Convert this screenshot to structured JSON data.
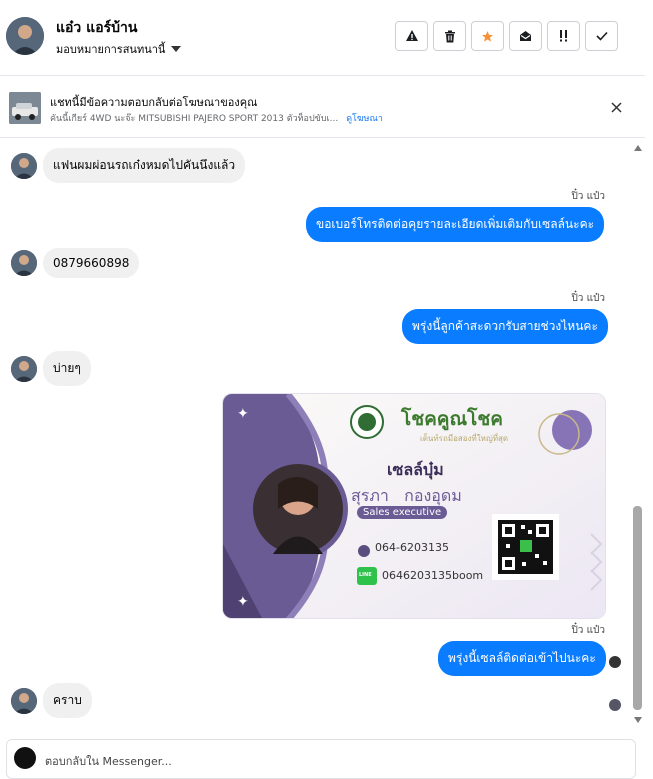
{
  "header": {
    "name": "แอ๋ว แอร์บ้าน",
    "assign_label": "มอบหมายการสนทนานี้",
    "tools": [
      {
        "icon": "warning-icon",
        "glyph": "⚠"
      },
      {
        "icon": "trash-icon",
        "glyph": "🗑"
      },
      {
        "icon": "star-icon",
        "glyph": "★"
      },
      {
        "icon": "mark-unread-icon",
        "glyph": "✉"
      },
      {
        "icon": "follow-up-icon",
        "glyph": "!"
      },
      {
        "icon": "done-icon",
        "glyph": "✓"
      }
    ],
    "star_color": "#f7923a"
  },
  "ad": {
    "title": "แชทนี้มีข้อความตอบกลับต่อโฆษณาของคุณ",
    "subtitle": "คันนี้เกียร์ 4WD นะจ๊ะ MITSUBISHI PAJERO SPORT 2013 ตัวท็อปขับเ...",
    "link": "ดูโฆษณา"
  },
  "messages": {
    "m1": "แฟนผมผ่อนรถเก๋งหมดไปคันนึงแล้ว",
    "s1": "ปิ๋ว แป๋ว",
    "m2": "ขอเบอร์โทรติดต่อคุยรายละเอียดเพิ่มเติมกับเซลล์นะคะ",
    "m3": "0879660898",
    "s2": "ปิ๋ว แป๋ว",
    "m4": "พรุ่งนี้ลูกค้าสะดวกรับสายช่วงไหนคะ",
    "m5": "บ่ายๆ",
    "s3": "ปิ๋ว แป๋ว",
    "m6": "พรุ่งนี้เซลล์ติดต่อเข้าไปนะคะ",
    "m7": "คราบ"
  },
  "card": {
    "brand": "โชคคูณโชค",
    "tagline": "เต็นท์รถมือสองที่ใหญ่ที่สุด",
    "nickname": "เซลล์บุ๋ม",
    "fullname": "สุรภา   กองอุดม",
    "role": "Sales executive",
    "phone": "064-6203135",
    "line_label": "LINE",
    "line_id": "0646203135boom",
    "accent": "#6b5b95"
  },
  "composer": {
    "placeholder": "ตอบกลับใน Messenger..."
  },
  "colors": {
    "outgoing": "#0a7cff",
    "incoming": "#f0f0f0"
  }
}
